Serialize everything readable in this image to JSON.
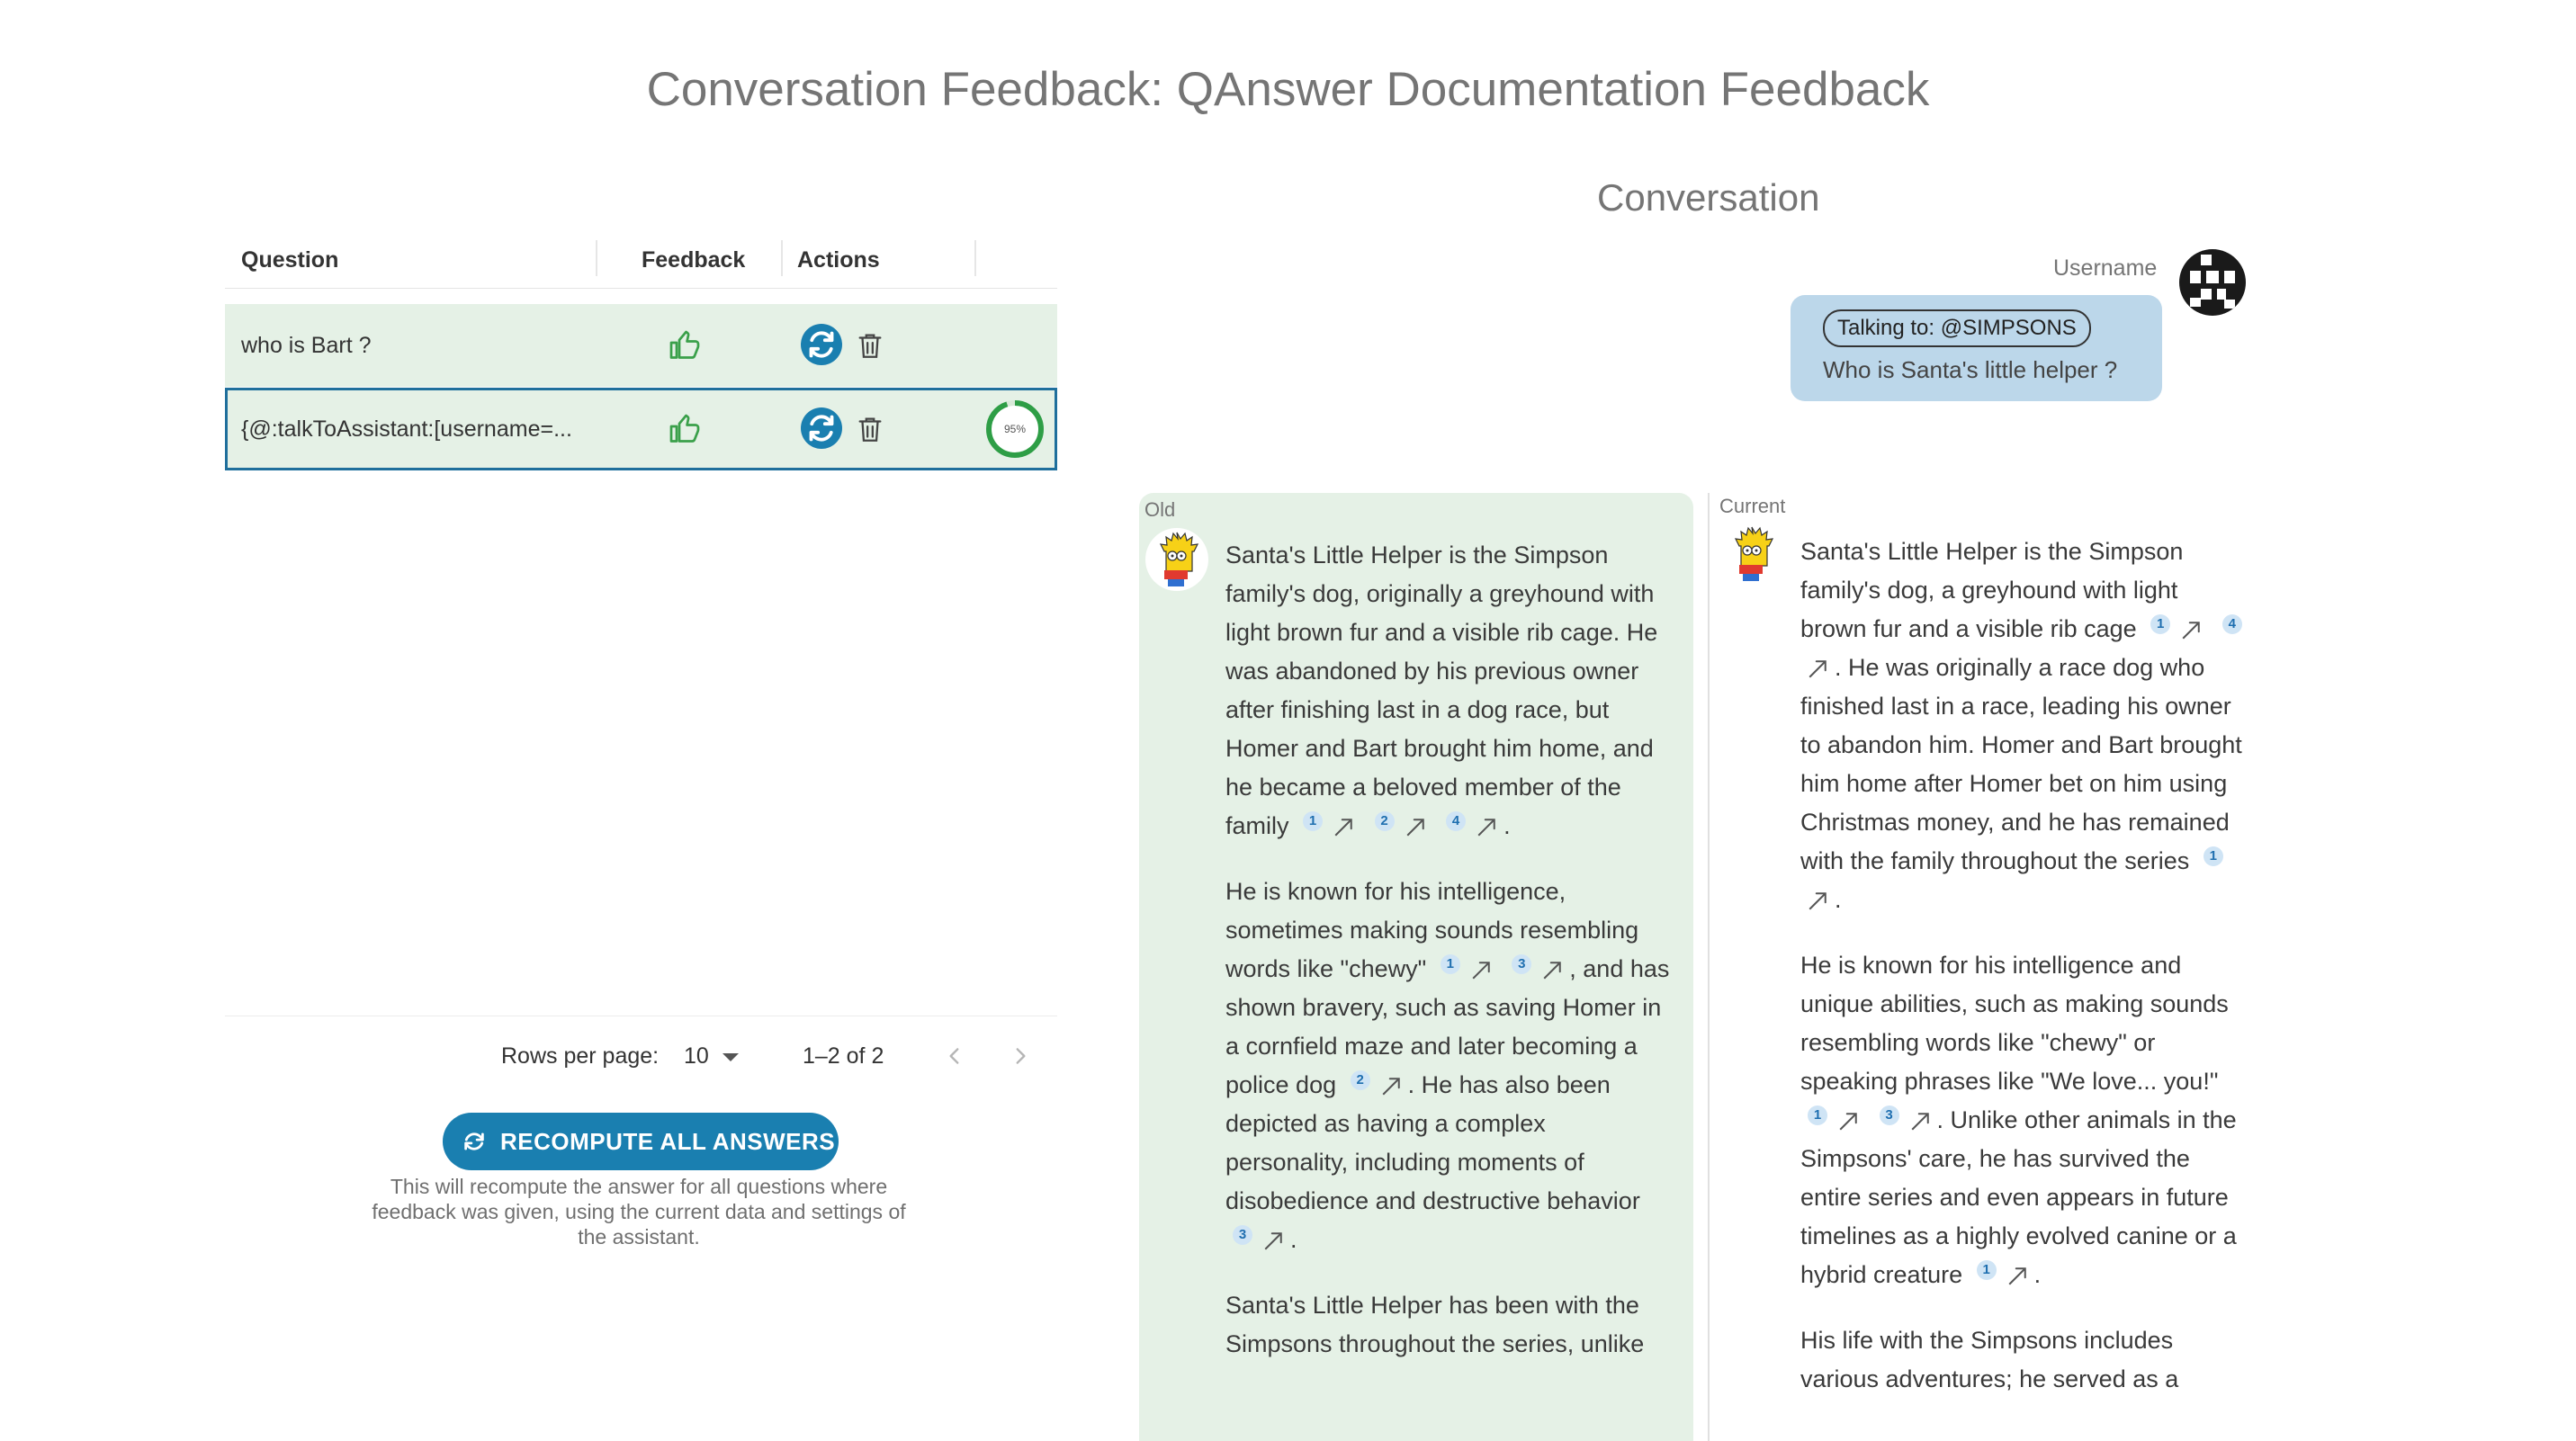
{
  "title": "Conversation Feedback: QAnswer Documentation Feedback",
  "table": {
    "headers": {
      "question": "Question",
      "feedback": "Feedback",
      "actions": "Actions"
    },
    "rows": [
      {
        "question": "who is Bart ?",
        "feedback": "thumbs-up",
        "selected": false
      },
      {
        "question": "{@:talkToAssistant:[username=...",
        "feedback": "thumbs-up",
        "selected": true,
        "progress_label": "95%",
        "progress": 0.95
      }
    ],
    "pagination": {
      "rows_per_page_label": "Rows per page:",
      "rows_per_page_value": "10",
      "page_info": "1–2 of 2"
    }
  },
  "recompute": {
    "button_label": "RECOMPUTE ALL ANSWERS",
    "note": "This will recompute the answer for all questions where feedback was given, using the current data and settings of the assistant."
  },
  "conversation": {
    "title": "Conversation",
    "username": "Username",
    "talking_to": "Talking to: @SIMPSONS",
    "question": "Who is Santa's little helper ?",
    "old_label": "Old",
    "current_label": "Current",
    "old_answer": {
      "p1": "Santa's Little Helper is the Simpson family's dog, originally a greyhound with light brown fur and a visible rib cage. He was abandoned by his previous owner after finishing last in a dog race, but Homer and Bart brought him home, and he became a beloved member of the family",
      "p1_refs": [
        "1",
        "2",
        "4"
      ],
      "p2a": "He is known for his intelligence, sometimes making sounds resembling words like \"chewy\"",
      "p2a_refs": [
        "1",
        "3"
      ],
      "p2b": ", and has shown bravery, such as saving Homer in a cornfield maze and later becoming a police dog",
      "p2b_refs": [
        "2"
      ],
      "p2c": ". He has also been depicted as having a complex personality, including moments of disobedience and destructive behavior",
      "p2c_refs": [
        "3"
      ],
      "p3": "Santa's Little Helper has been with the Simpsons throughout the series, unlike"
    },
    "current_answer": {
      "p1a": "Santa's Little Helper is the Simpson family's dog, a greyhound with light brown fur and a visible rib cage",
      "p1a_refs": [
        "1",
        "4"
      ],
      "p1b": ". He was originally a race dog who finished last in a race, leading his owner to abandon him. Homer and Bart brought him home after Homer bet on him using Christmas money, and he has remained with the family throughout the series",
      "p1b_refs": [
        "1"
      ],
      "p2a": "He is known for his intelligence and unique abilities, such as making sounds resembling words like \"chewy\" or speaking phrases like \"We love... you!\"",
      "p2a_refs": [
        "1",
        "3"
      ],
      "p2b": ". Unlike other animals in the Simpsons' care, he has survived the entire series and even appears in future timelines as a highly evolved canine or a hybrid creature",
      "p2b_refs": [
        "1"
      ],
      "p3": "His life with the Simpsons includes various adventures; he served as a"
    }
  },
  "colors": {
    "accent": "#1a7fb0",
    "row_bg": "#e5f1e6",
    "bubble_bg": "#bcd7ea",
    "progress": "#2e9e46",
    "thumb": "#3aa04a"
  }
}
